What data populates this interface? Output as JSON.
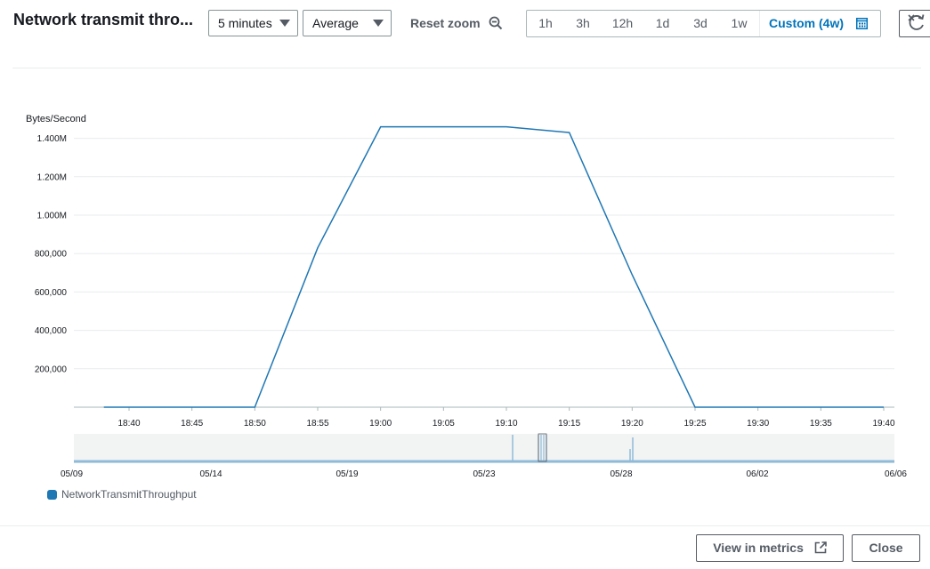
{
  "header": {
    "title": "Network transmit thro...",
    "period_select": "5 minutes",
    "stat_select": "Average",
    "reset_zoom_label": "Reset zoom",
    "time_ranges": [
      "1h",
      "3h",
      "12h",
      "1d",
      "3d",
      "1w"
    ],
    "custom_range_label": "Custom (4w)"
  },
  "footer": {
    "view_metrics_label": "View in metrics",
    "close_label": "Close"
  },
  "colors": {
    "series": "#1f77b4",
    "accent": "#0073bb",
    "overview": "#8fbbd9"
  },
  "chart_data": [
    {
      "type": "line",
      "ylabel": "Bytes/Second",
      "y_ticks": [
        "200,000",
        "400,000",
        "600,000",
        "800,000",
        "1.000M",
        "1.200M",
        "1.400M"
      ],
      "x_ticks": [
        "18:40",
        "18:45",
        "18:50",
        "18:55",
        "19:00",
        "19:05",
        "19:10",
        "19:15",
        "19:20",
        "19:25",
        "19:30",
        "19:35",
        "19:40"
      ],
      "ylim": [
        0,
        1500000
      ],
      "grid": true,
      "legend_position": "bottom-left",
      "series": [
        {
          "name": "NetworkTransmitThroughput",
          "x": [
            "18:38",
            "18:50",
            "18:55",
            "19:00",
            "19:10",
            "19:15",
            "19:20",
            "19:25",
            "19:30",
            "19:35",
            "19:40"
          ],
          "values": [
            0,
            0,
            830000,
            1460000,
            1460000,
            1430000,
            690000,
            0,
            0,
            0,
            0
          ]
        }
      ]
    },
    {
      "type": "area",
      "x_ticks": [
        "05/09",
        "05/14",
        "05/19",
        "05/23",
        "05/28",
        "06/02",
        "06/06"
      ]
    }
  ]
}
